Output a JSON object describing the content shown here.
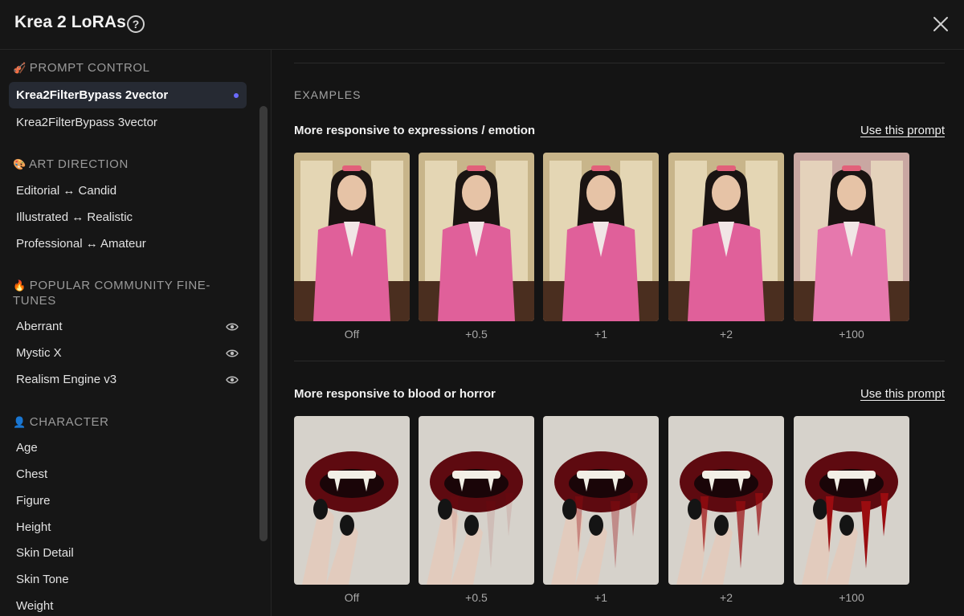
{
  "header": {
    "title": "Krea 2 LoRAs"
  },
  "sidebar": {
    "sections": [
      {
        "emoji": "🎻",
        "label": "PROMPT CONTROL",
        "items": [
          "Krea2FilterBypass 2vector",
          "Krea2FilterBypass 3vector"
        ]
      },
      {
        "emoji": "🎨",
        "label": "ART DIRECTION",
        "items": [
          "Editorial ↔ Candid",
          "Illustrated ↔ Realistic",
          "Professional ↔ Amateur"
        ]
      },
      {
        "emoji": "🔥",
        "label": "POPULAR COMMUNITY FINE-TUNES",
        "items": [
          "Aberrant",
          "Mystic X",
          "Realism Engine v3"
        ]
      },
      {
        "emoji": "👤",
        "label": "CHARACTER",
        "items": [
          "Age",
          "Chest",
          "Figure",
          "Height",
          "Skin Detail",
          "Skin Tone",
          "Weight"
        ]
      }
    ],
    "active_item": "Krea2FilterBypass 2vector"
  },
  "main": {
    "examples_label": "EXAMPLES",
    "use_prompt_label": "Use this prompt",
    "examples": [
      {
        "title": "More responsive to expressions / emotion",
        "captions": [
          "Off",
          "+0.5",
          "+1",
          "+2",
          "+100"
        ]
      },
      {
        "title": "More responsive to blood or horror",
        "captions": [
          "Off",
          "+0.5",
          "+1",
          "+2",
          "+100"
        ]
      }
    ]
  },
  "colors": {
    "accent_dot": "#6b6bff",
    "blazer_pink": "#e0609a",
    "lip_red": "#7a0e14",
    "blood": "#9a0c10"
  }
}
